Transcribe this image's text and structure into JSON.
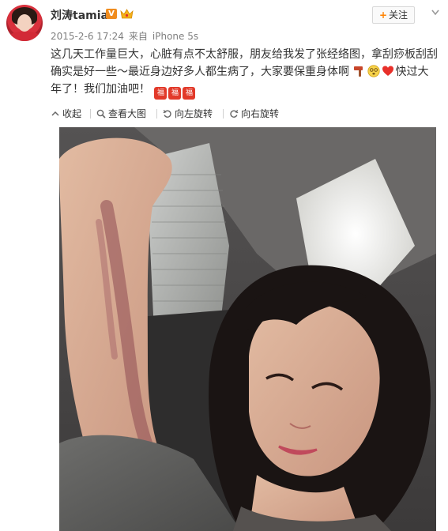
{
  "user": {
    "name": "刘涛tamia",
    "vip_badge": "V",
    "follow_label": "关注",
    "follow_plus": "+"
  },
  "meta": {
    "date": "2015-2-6 17:24",
    "source_prefix": "来自",
    "source": "iPhone 5s"
  },
  "post": {
    "text_part1": "这几天工作量巨大，心脏有点不太舒服，朋友给我发了张经络图，拿刮痧板刮刮确实是好一些～最近身边好多人都生病了，大家要保重身体啊",
    "text_part2": "快过大年了！我们加油吧！",
    "emoji_box_char": "福"
  },
  "actions": {
    "collapse": "收起",
    "view_large": "查看大图",
    "rotate_left": "向左旋转",
    "rotate_right": "向右旋转"
  },
  "colors": {
    "accent_orange": "#ff8200",
    "text_main": "#333333",
    "text_meta": "#808080",
    "emoji_red": "#e23a2a"
  },
  "icons": {
    "collapse": "collapse-icon",
    "view_large": "search-icon",
    "rotate_left": "rotate-left-icon",
    "rotate_right": "rotate-right-icon",
    "menu": "chevron-down-icon",
    "crown": "crown-icon"
  }
}
